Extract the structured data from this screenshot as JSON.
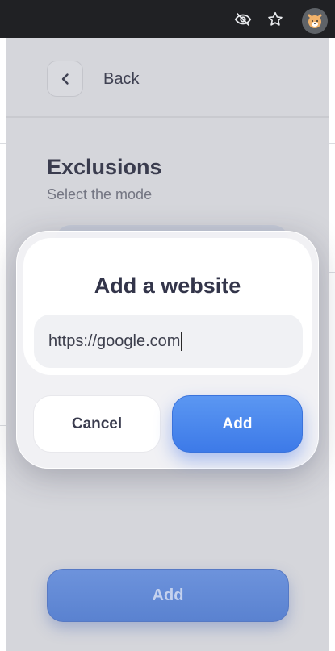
{
  "browser": {
    "icons": [
      "eye-off-icon",
      "star-icon",
      "extension-avatar-icon"
    ]
  },
  "popup": {
    "back_label": "Back",
    "section_title": "Exclusions",
    "section_subtitle": "Select the mode",
    "bottom_add_label": "Add"
  },
  "modal": {
    "title": "Add a website",
    "url_value": "https://google.com",
    "cancel_label": "Cancel",
    "add_label": "Add"
  },
  "colors": {
    "accent": "#3d7ae8",
    "popup_bg": "#d5d6db",
    "title_text": "#33354a"
  }
}
